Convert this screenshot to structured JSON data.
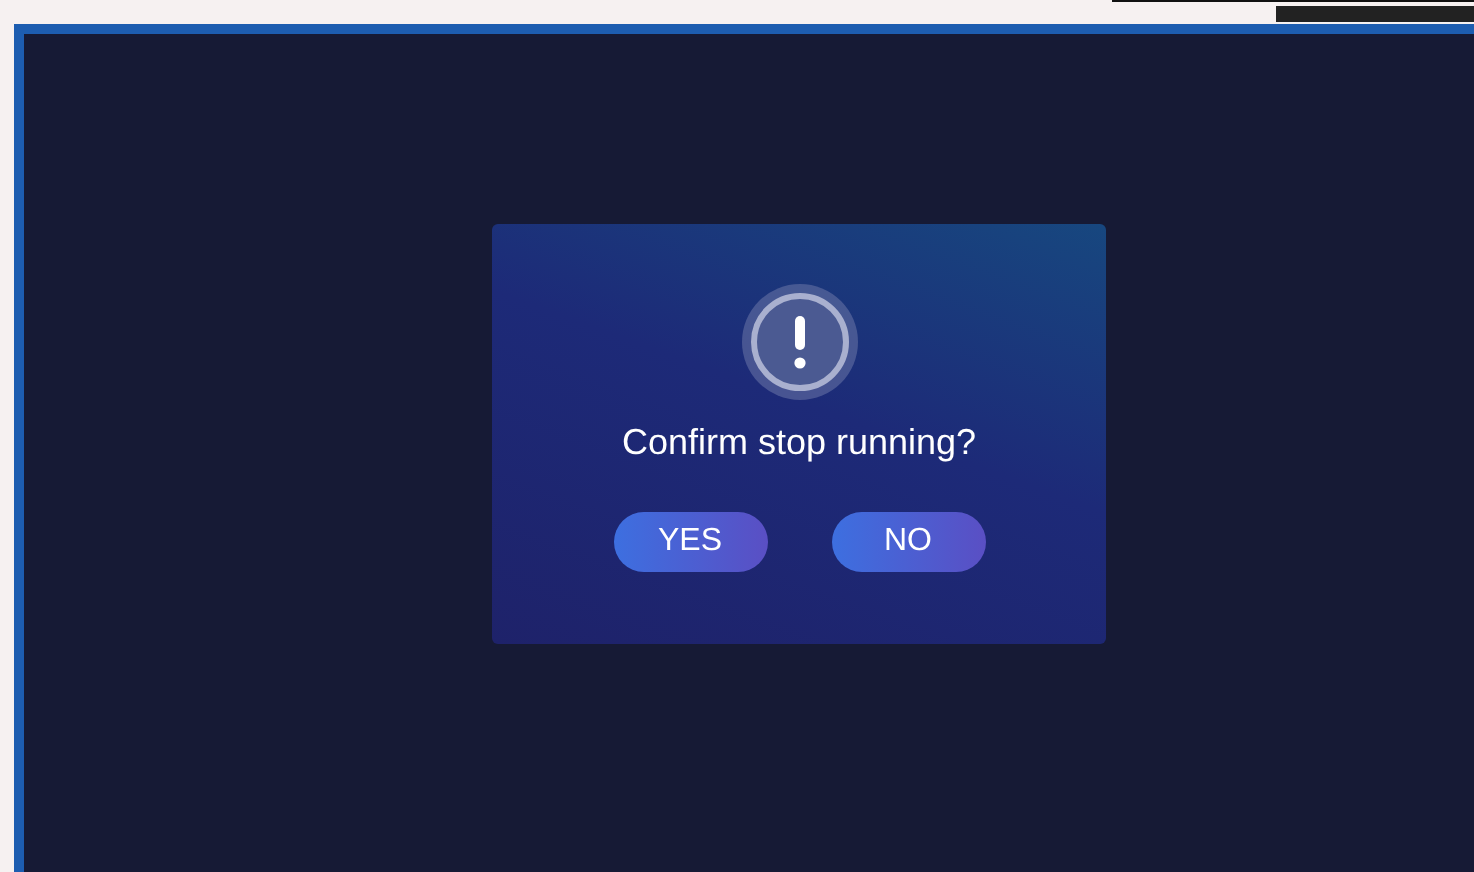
{
  "dialog": {
    "message": "Confirm stop running?",
    "buttons": [
      {
        "label": "YES"
      },
      {
        "label": "NO"
      }
    ]
  }
}
